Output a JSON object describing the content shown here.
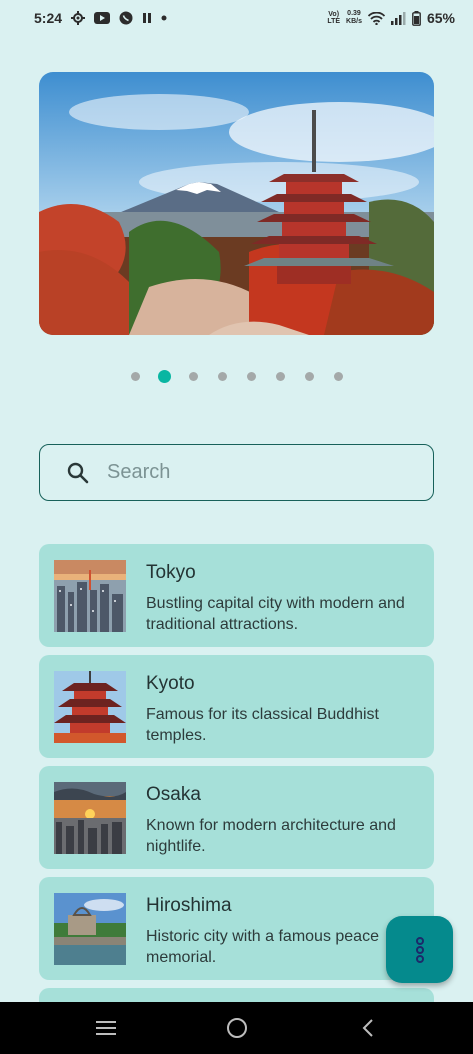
{
  "status_bar": {
    "time": "5:24",
    "net_label_top": "Vo) ",
    "net_label_bottom": "LTE",
    "speed_value": "0.39",
    "speed_unit": "KB/s",
    "battery_percent": "65%"
  },
  "carousel": {
    "total_slides": 8,
    "active_index": 1
  },
  "search": {
    "placeholder": "Search",
    "value": ""
  },
  "cities": [
    {
      "name": "Tokyo",
      "description": "Bustling capital city with modern and traditional attractions."
    },
    {
      "name": "Kyoto",
      "description": "Famous for its classical Buddhist temples."
    },
    {
      "name": "Osaka",
      "description": "Known for modern architecture and nightlife."
    },
    {
      "name": "Hiroshima",
      "description": "Historic city with a famous peace memorial."
    }
  ],
  "fab": {
    "icon": "more-vertical-icon"
  },
  "nav": {
    "icons": [
      "recents-icon",
      "home-icon",
      "back-icon"
    ]
  },
  "colors": {
    "background": "#daf1f1",
    "card": "#a6e0d9",
    "accent": "#09b6a2",
    "fab": "#058a8d"
  }
}
